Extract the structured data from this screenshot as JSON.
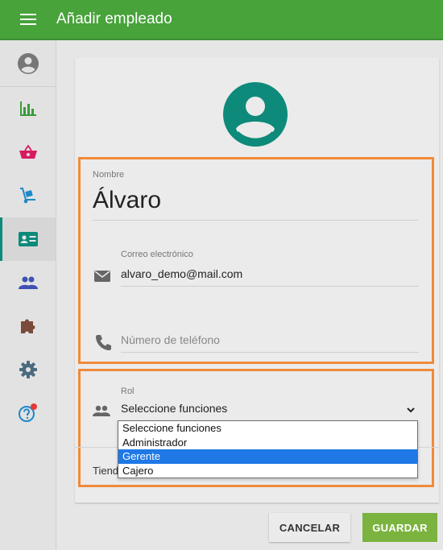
{
  "header": {
    "title": "Añadir empleado"
  },
  "sidebar": {
    "items": [
      {
        "icon": "account-circle-icon"
      },
      {
        "icon": "bar-chart-icon"
      },
      {
        "icon": "basket-icon"
      },
      {
        "icon": "hand-truck-icon"
      },
      {
        "icon": "badge-icon",
        "active": true
      },
      {
        "icon": "people-icon"
      },
      {
        "icon": "puzzle-icon"
      },
      {
        "icon": "gear-icon"
      },
      {
        "icon": "help-icon",
        "badge": true
      }
    ]
  },
  "form": {
    "name": {
      "label": "Nombre",
      "value": "Álvaro"
    },
    "email": {
      "label": "Correo electrónico",
      "value": "alvaro_demo@mail.com"
    },
    "phone": {
      "placeholder": "Número de teléfono"
    },
    "role": {
      "label": "Rol",
      "value": "Seleccione funciones"
    },
    "store": {
      "label_partial": "Tiend"
    }
  },
  "dropdown": {
    "options": [
      "Seleccione funciones",
      "Administrador",
      "Gerente",
      "Cajero"
    ],
    "highlighted": "Gerente"
  },
  "buttons": {
    "cancel": "CANCELAR",
    "save": "GUARDAR"
  },
  "colors": {
    "header": "#47a33a",
    "accent_teal": "#0d8a7a",
    "highlight_box": "#f08a3a",
    "save_button": "#7bb33f",
    "dropdown_selected": "#1e78e6"
  }
}
